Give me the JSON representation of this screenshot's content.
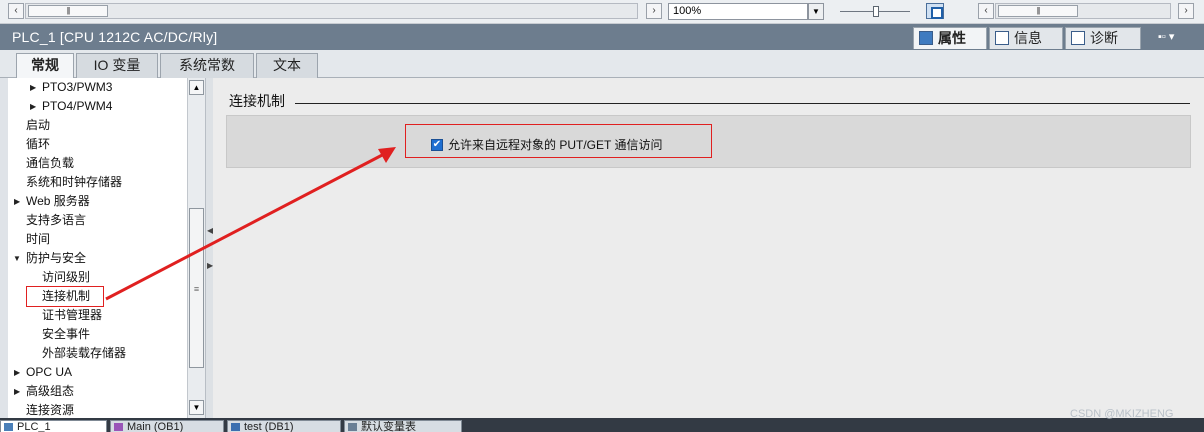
{
  "toolbar": {
    "zoom_value": "100%",
    "scroll_left_arrow": "‹",
    "scroll_right_arrow": "›",
    "thumb_grip": "|||"
  },
  "title_bar": {
    "title": "PLC_1 [CPU 1212C AC/DC/Rly]",
    "inspector_tabs": [
      {
        "label": "属性",
        "icon": "properties-icon",
        "active": true
      },
      {
        "label": "信息",
        "icon": "info-icon",
        "active": false
      },
      {
        "label": "诊断",
        "icon": "diagnostics-icon",
        "active": false
      }
    ],
    "window_controls": "▪▫ ▾"
  },
  "tabs": [
    {
      "label": "常规",
      "active": true
    },
    {
      "label": "IO 变量",
      "active": false
    },
    {
      "label": "系统常数",
      "active": false
    },
    {
      "label": "文本",
      "active": false
    }
  ],
  "tree": {
    "items": [
      {
        "label": "PTO3/PWM3",
        "level": 1,
        "expander": "collapsed"
      },
      {
        "label": "PTO4/PWM4",
        "level": 1,
        "expander": "collapsed"
      },
      {
        "label": "启动",
        "level": 0,
        "expander": "none"
      },
      {
        "label": "循环",
        "level": 0,
        "expander": "none"
      },
      {
        "label": "通信负载",
        "level": 0,
        "expander": "none"
      },
      {
        "label": "系统和时钟存储器",
        "level": 0,
        "expander": "none"
      },
      {
        "label": "Web 服务器",
        "level": 0,
        "expander": "collapsed"
      },
      {
        "label": "支持多语言",
        "level": 0,
        "expander": "none"
      },
      {
        "label": "时间",
        "level": 0,
        "expander": "none"
      },
      {
        "label": "防护与安全",
        "level": 0,
        "expander": "expanded"
      },
      {
        "label": "访问级别",
        "level": 1,
        "expander": "none"
      },
      {
        "label": "连接机制",
        "level": 1,
        "expander": "none",
        "selected": true
      },
      {
        "label": "证书管理器",
        "level": 1,
        "expander": "none"
      },
      {
        "label": "安全事件",
        "level": 1,
        "expander": "none"
      },
      {
        "label": "外部装载存储器",
        "level": 1,
        "expander": "none"
      },
      {
        "label": "OPC UA",
        "level": 0,
        "expander": "collapsed"
      },
      {
        "label": "高级组态",
        "level": 0,
        "expander": "collapsed"
      },
      {
        "label": "连接资源",
        "level": 0,
        "expander": "none"
      }
    ],
    "scroll_up": "▲",
    "scroll_down": "▼",
    "thumb_grip": "≡"
  },
  "content": {
    "section_heading": "连接机制",
    "checkbox": {
      "label": "允许来自远程对象的 PUT/GET 通信访问",
      "checked": true,
      "check_glyph": "✔"
    }
  },
  "taskbar": {
    "tabs": [
      {
        "label": "PLC_1",
        "active": true
      },
      {
        "label": "Main (OB1)",
        "active": false
      },
      {
        "label": "test (DB1)",
        "active": false
      },
      {
        "label": "默认变量表",
        "active": false
      }
    ]
  },
  "watermark": "CSDN @MKIZHENG",
  "colors": {
    "title_bar": "#6d7d8e",
    "annotation_red": "#e02020",
    "checkbox_blue": "#1f6fd1"
  }
}
